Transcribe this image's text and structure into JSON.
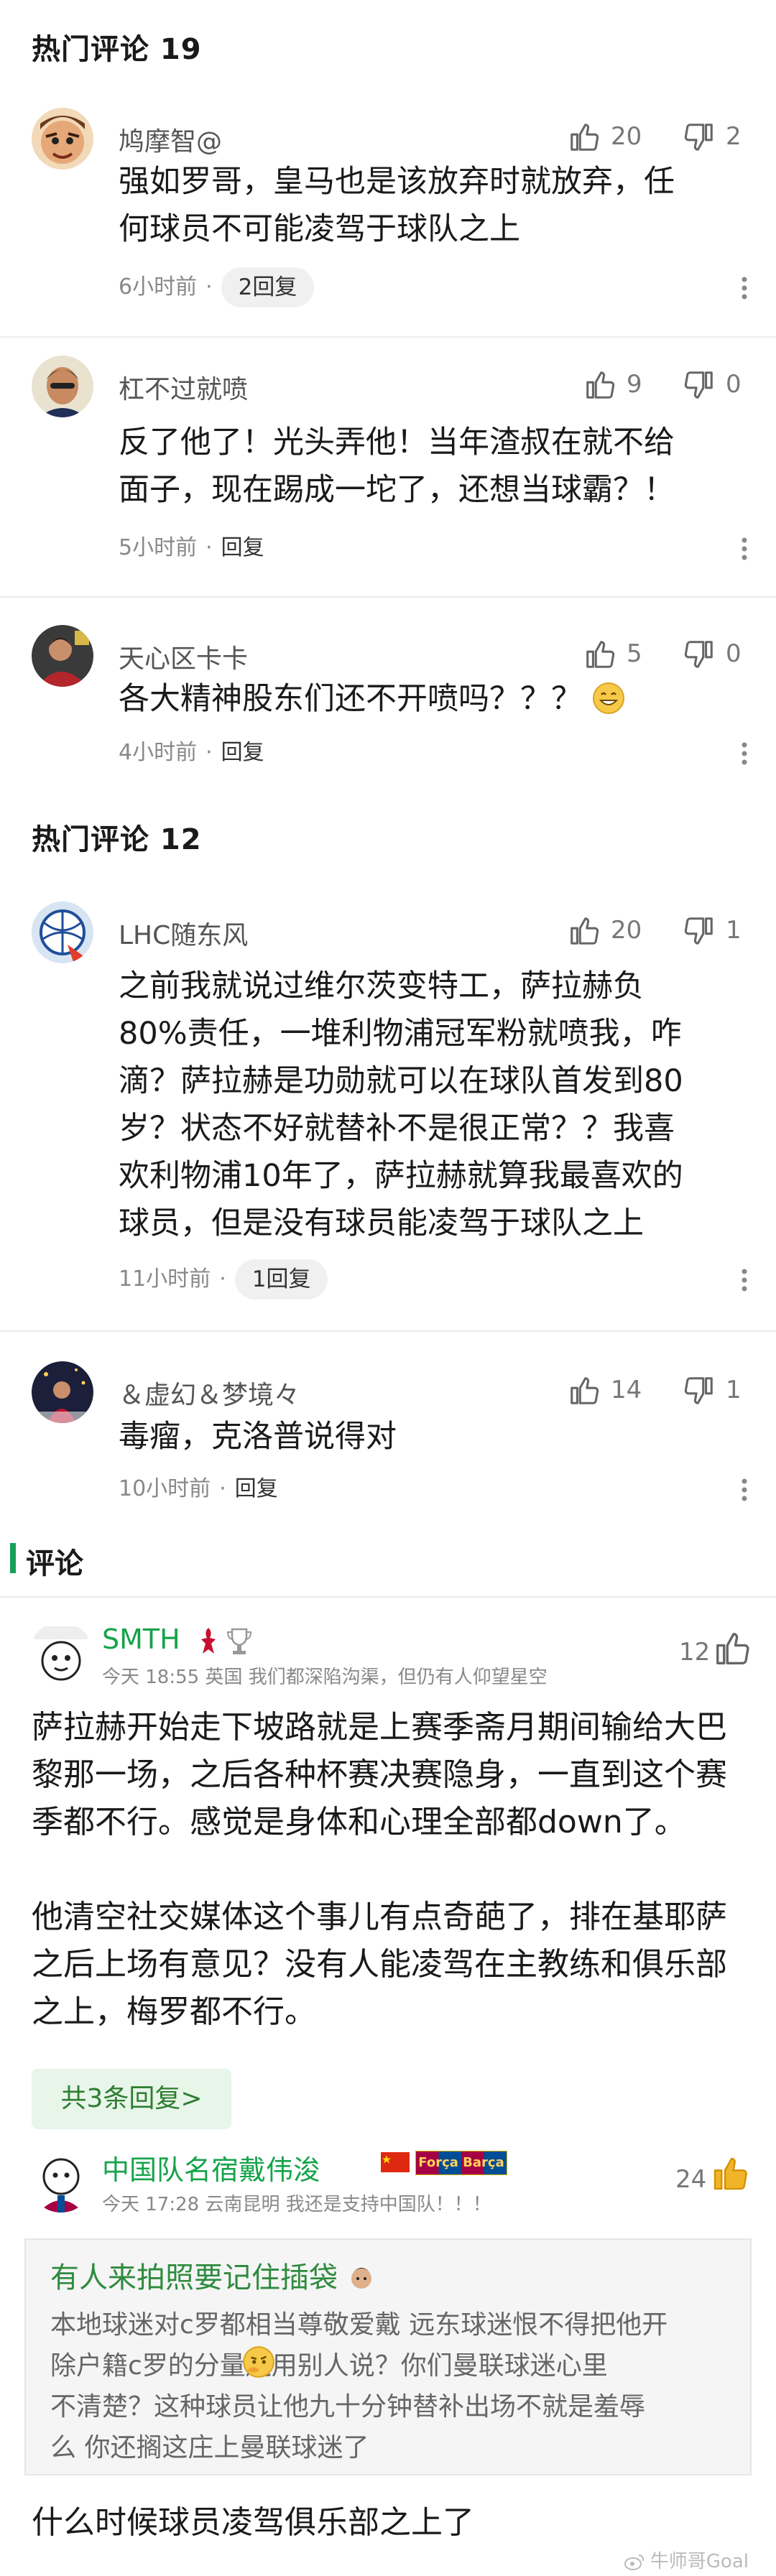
{
  "hot1": {
    "title": "热门评论 19",
    "comments": [
      {
        "user": "鸠摩智@",
        "likes": "20",
        "dislikes": "2",
        "lines": [
          "强如罗哥，皇马也是该放弃时就放弃，任",
          "何球员不可能凌驾于球队之上"
        ],
        "time": "6小时前",
        "dot": "·",
        "reply": "2回复"
      },
      {
        "user": "杠不过就喷",
        "likes": "9",
        "dislikes": "0",
        "lines": [
          "反了他了！光头弄他！当年渣叔在就不给",
          "面子，现在踢成一坨了，还想当球霸？！"
        ],
        "time": "5小时前",
        "dot": "·",
        "reply": "回复"
      },
      {
        "user": "天心区卡卡",
        "likes": "5",
        "dislikes": "0",
        "lines": [
          "各大精神股东们还不开喷吗？？？"
        ],
        "time": "4小时前",
        "dot": "·",
        "reply": "回复"
      }
    ]
  },
  "hot2": {
    "title": "热门评论 12",
    "comments": [
      {
        "user": "LHC随东风",
        "likes": "20",
        "dislikes": "1",
        "lines": [
          "之前我就说过维尔茨变特工，萨拉赫负",
          "80%责任，一堆利物浦冠军粉就喷我，咋",
          "滴？萨拉赫是功勋就可以在球队首发到80",
          "岁？状态不好就替补不是很正常？？我喜",
          "欢利物浦10年了，萨拉赫就算我最喜欢的",
          "球员，但是没有球员能凌驾于球队之上"
        ],
        "time": "11小时前",
        "dot": "·",
        "reply": "1回复"
      },
      {
        "user": "＆虚幻＆梦境々",
        "likes": "14",
        "dislikes": "1",
        "lines": [
          "毒瘤，克洛普说得对"
        ],
        "time": "10小时前",
        "dot": "·",
        "reply": "回复"
      }
    ]
  },
  "comments_section": {
    "title": "评论",
    "c1": {
      "user": "SMTH",
      "time": "今天 18:55",
      "location": "英国",
      "sig": "我们都深陷沟渠，但仍有人仰望星空",
      "likes": "12",
      "paragraph1": [
        "萨拉赫开始走下坡路就是上赛季斋月期间输给大巴",
        "黎那一场，之后各种杯赛决赛隐身，一直到这个赛",
        "季都不行。感觉是身体和心理全部都down了。"
      ],
      "paragraph2": [
        "他清空社交媒体这个事儿有点奇葩了，排在基耶萨",
        "之后上场有意见？没有人能凌驾在主教练和俱乐部",
        "之上，梅罗都不行。"
      ],
      "replies_btn": "共3条回复>"
    },
    "c2": {
      "user": "中国队名宿戴伟浚",
      "badge": "Força Barça",
      "time": "今天 17:28",
      "location": "云南昆明",
      "sig": "我还是支持中国队！！！",
      "likes": "24",
      "quote_title": "有人来拍照要记住插袋",
      "quote_lines": [
        "本地球迷对c罗都相当尊敬爱戴 远东球迷恨不得把他开",
        "除户籍c罗的分量还用别人说？你们曼联球迷心里",
        "不清楚？这种球员让他九十分钟替补出场不就是羞辱",
        "么 你还搁这庄上曼联球迷了"
      ],
      "text": "什么时候球员凌驾俱乐部之上了"
    },
    "watermark": "牛师哥Goal"
  },
  "colors": {
    "accent_green": "#16a34a",
    "gray_text": "#888888"
  }
}
